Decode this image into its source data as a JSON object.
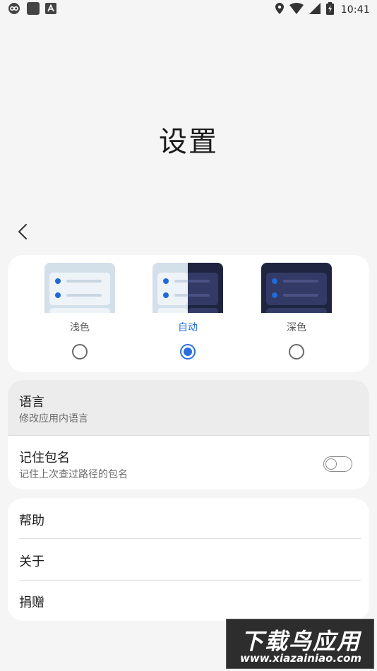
{
  "status_bar": {
    "time": "10:41",
    "left_icons": [
      "infinity-icon",
      "square-icon",
      "letter-a-icon"
    ],
    "right_icons": [
      "location-icon",
      "wifi-icon",
      "signal-icon",
      "battery-charging-icon"
    ]
  },
  "page": {
    "title": "设置"
  },
  "theme": {
    "options": [
      {
        "label": "浅色",
        "selected": false
      },
      {
        "label": "自动",
        "selected": true
      },
      {
        "label": "深色",
        "selected": false
      }
    ],
    "accent_color": "#2b6fdc"
  },
  "settings": {
    "language": {
      "title": "语言",
      "subtitle": "修改应用内语言"
    },
    "remember": {
      "title": "记住包名",
      "subtitle": "记住上次查过路径的包名",
      "enabled": false
    }
  },
  "info": {
    "help": "帮助",
    "about": "关于",
    "donate": "捐赠"
  },
  "watermark": {
    "title": "下载鸟应用",
    "url": "www.xiazainiao.com"
  }
}
